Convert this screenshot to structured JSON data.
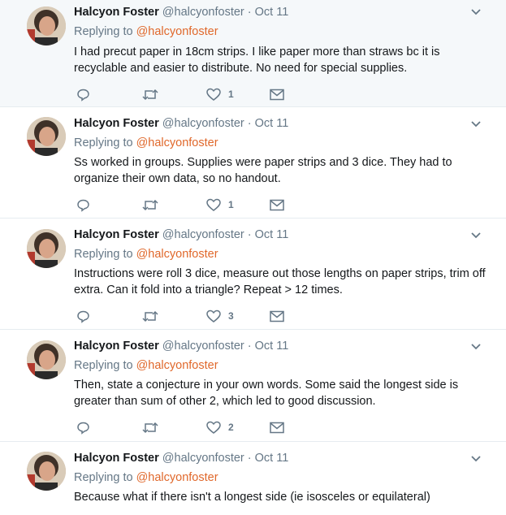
{
  "tweets": [
    {
      "name": "Halcyon Foster",
      "handle": "@halcyonfoster",
      "dot": "·",
      "time": "Oct 11",
      "reply_prefix": "Replying to",
      "reply_mention": "@halcyonfoster",
      "text": "I had precut paper in 18cm strips. I like paper more than straws bc it is recyclable and easier to distribute. No need for special supplies.",
      "like_count": "1",
      "highlighted": true
    },
    {
      "name": "Halcyon Foster",
      "handle": "@halcyonfoster",
      "dot": "·",
      "time": "Oct 11",
      "reply_prefix": "Replying to",
      "reply_mention": "@halcyonfoster",
      "text": "Ss worked in groups. Supplies were paper strips and 3 dice. They had to organize their own data, so no handout.",
      "like_count": "1",
      "highlighted": false
    },
    {
      "name": "Halcyon Foster",
      "handle": "@halcyonfoster",
      "dot": "·",
      "time": "Oct 11",
      "reply_prefix": "Replying to",
      "reply_mention": "@halcyonfoster",
      "text": "Instructions were roll 3 dice, measure out those lengths on paper strips, trim off extra. Can it fold into a triangle? Repeat > 12 times.",
      "like_count": "3",
      "highlighted": false
    },
    {
      "name": "Halcyon Foster",
      "handle": "@halcyonfoster",
      "dot": "·",
      "time": "Oct 11",
      "reply_prefix": "Replying to",
      "reply_mention": "@halcyonfoster",
      "text": "Then, state a conjecture in your own words.  Some said the longest side is greater than sum of other 2, which led to good discussion.",
      "like_count": "2",
      "highlighted": false
    },
    {
      "name": "Halcyon Foster",
      "handle": "@halcyonfoster",
      "dot": "·",
      "time": "Oct 11",
      "reply_prefix": "Replying to",
      "reply_mention": "@halcyonfoster",
      "text": "Because what if there isn't a longest side (ie isosceles or equilateral)",
      "like_count": "",
      "highlighted": false
    }
  ],
  "icons": {
    "reply": "reply-icon",
    "retweet": "retweet-icon",
    "like": "heart-icon",
    "dm": "envelope-icon",
    "caret": "chevron-down-icon"
  },
  "colors": {
    "highlight_bg": "#f5f8fa",
    "mention": "#e0682b",
    "muted": "#657786",
    "divider": "#e6ecf0"
  }
}
